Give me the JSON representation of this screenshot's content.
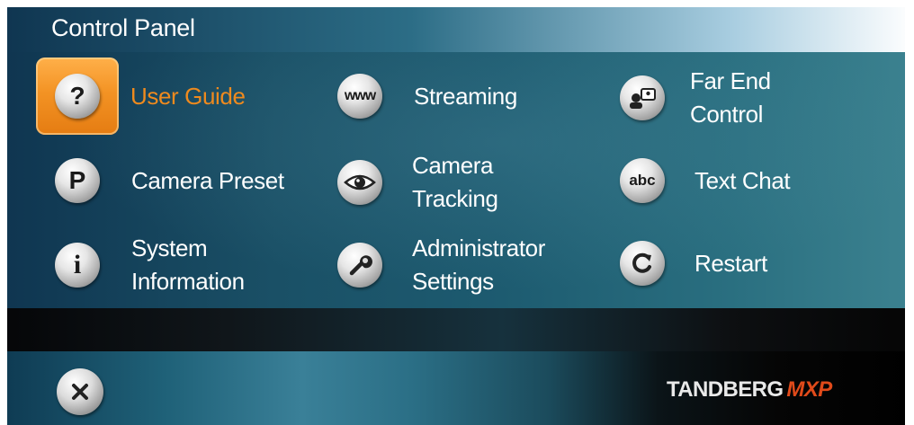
{
  "title": "Control Panel",
  "menu": [
    {
      "id": "user-guide",
      "label_lines": [
        "User Guide"
      ],
      "icon": "question-icon",
      "active": true
    },
    {
      "id": "streaming",
      "label_lines": [
        "Streaming"
      ],
      "icon": "www-icon"
    },
    {
      "id": "far-end-control",
      "label_lines": [
        "Far End",
        "Control"
      ],
      "icon": "far-end-camera-icon"
    },
    {
      "id": "camera-preset",
      "label_lines": [
        "Camera Preset"
      ],
      "icon": "preset-p-icon"
    },
    {
      "id": "camera-tracking",
      "label_lines": [
        "Camera",
        "Tracking"
      ],
      "icon": "eye-icon"
    },
    {
      "id": "text-chat",
      "label_lines": [
        "Text Chat"
      ],
      "icon": "abc-icon"
    },
    {
      "id": "system-information",
      "label_lines": [
        "System",
        "Information"
      ],
      "icon": "info-icon"
    },
    {
      "id": "administrator-settings",
      "label_lines": [
        "Administrator",
        "Settings"
      ],
      "icon": "wrench-icon"
    },
    {
      "id": "restart",
      "label_lines": [
        "Restart"
      ],
      "icon": "restart-icon"
    }
  ],
  "icon_text": {
    "question": "?",
    "www": "www",
    "preset": "P",
    "abc": "abc",
    "info": "i"
  },
  "close": {
    "icon": "close-icon"
  },
  "brand": {
    "name": "TANDBERG",
    "suffix": "MXP"
  },
  "colors": {
    "active_label": "#ee8a1e",
    "highlight": "#f39324",
    "brand_suffix": "#e04a1a"
  }
}
